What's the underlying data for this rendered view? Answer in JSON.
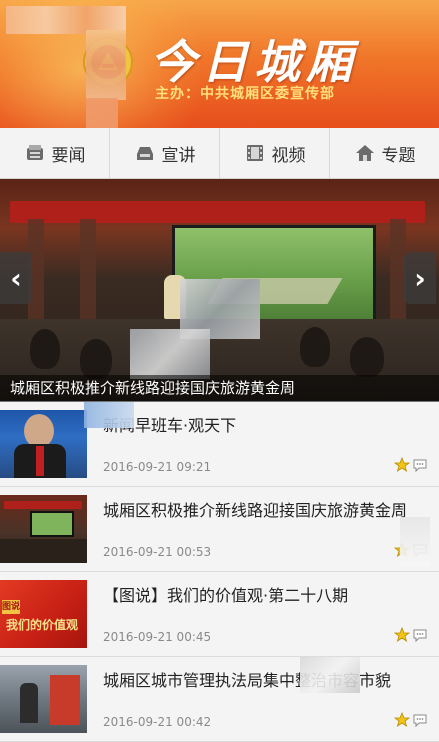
{
  "header": {
    "app_title": "今日城厢",
    "subtitle": "主办：中共城厢区委宣传部"
  },
  "tabs": [
    {
      "label": "要闻",
      "icon": "newspaper-icon"
    },
    {
      "label": "宣讲",
      "icon": "inbox-icon"
    },
    {
      "label": "视频",
      "icon": "film-icon"
    },
    {
      "label": "专题",
      "icon": "home-icon"
    }
  ],
  "banner": {
    "caption": "城厢区积极推介新线路迎接国庆旅游黄金周",
    "prev_glyph": "‹",
    "next_glyph": "›"
  },
  "news": [
    {
      "title": "新闻早班车·观天下",
      "date": "2016-09-21 09:21"
    },
    {
      "title": "城厢区积极推介新线路迎接国庆旅游黄金周",
      "date": "2016-09-21 00:53"
    },
    {
      "title": "【图说】我们的价值观·第二十八期",
      "date": "2016-09-21 00:45"
    },
    {
      "title": "城厢区城市管理执法局集中整治市容市貌",
      "date": "2016-09-21 00:42"
    }
  ],
  "thumb_texts": {
    "values_poster": "我们的价值观",
    "values_tag": "图说"
  },
  "colors": {
    "header_orange": "#f0762a",
    "star_yellow": "#f3c316",
    "tab_bg": "#f3f3f3"
  }
}
